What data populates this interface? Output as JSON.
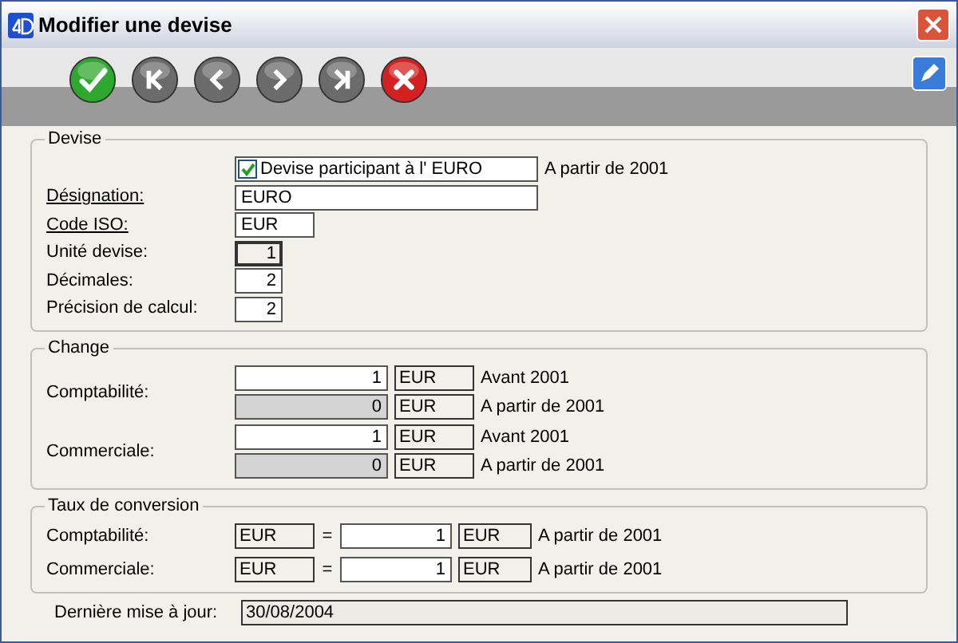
{
  "window": {
    "title": "Modifier une devise"
  },
  "toolbar": [
    {
      "kind": "validate"
    },
    {
      "kind": "first"
    },
    {
      "kind": "previous"
    },
    {
      "kind": "next"
    },
    {
      "kind": "last"
    },
    {
      "kind": "cancel"
    }
  ],
  "devise": {
    "title": "Devise",
    "rows": [
      {
        "kind": "checkbox",
        "label": "Devise participant à l' EURO",
        "checked": true,
        "note": "A partir de 2001"
      },
      {
        "kind": "text",
        "label": "Désignation:",
        "underlined": true,
        "value": "EURO",
        "disabled": false
      },
      {
        "kind": "code",
        "label": "Code ISO:",
        "underlined": true,
        "value": "EUR",
        "disabled": false
      },
      {
        "kind": "number",
        "label": "Unité devise:",
        "underlined": false,
        "value": "1",
        "disabled": true
      },
      {
        "kind": "number",
        "label": "Décimales:",
        "underlined": false,
        "value": "2",
        "disabled": false
      },
      {
        "kind": "number",
        "label": "Précision de calcul:",
        "underlined": false,
        "value": "2",
        "disabled": false
      }
    ]
  },
  "change": {
    "title": "Change",
    "groups": [
      {
        "label": "Comptabilité:",
        "lines": [
          {
            "value": "1",
            "unit": "EUR",
            "note": "Avant 2001",
            "disabled": false
          },
          {
            "value": "0",
            "unit": "EUR",
            "note": "A partir de 2001",
            "disabled": true
          }
        ]
      },
      {
        "label": "Commerciale:",
        "lines": [
          {
            "value": "1",
            "unit": "EUR",
            "note": "Avant 2001",
            "disabled": false
          },
          {
            "value": "0",
            "unit": "EUR",
            "note": "A partir de 2001",
            "disabled": true
          }
        ]
      }
    ]
  },
  "conversion": {
    "title": "Taux de conversion",
    "rows": [
      {
        "label": "Comptabilité:",
        "from": "EUR",
        "equals": "=",
        "value": "1",
        "unit": "EUR",
        "note": "A partir de 2001"
      },
      {
        "label": "Commerciale:",
        "from": "EUR",
        "equals": "=",
        "value": "1",
        "unit": "EUR",
        "note": "A partir de 2001"
      }
    ]
  },
  "last_update": {
    "label": "Dernière mise à jour:",
    "value": "30/08/2004"
  }
}
